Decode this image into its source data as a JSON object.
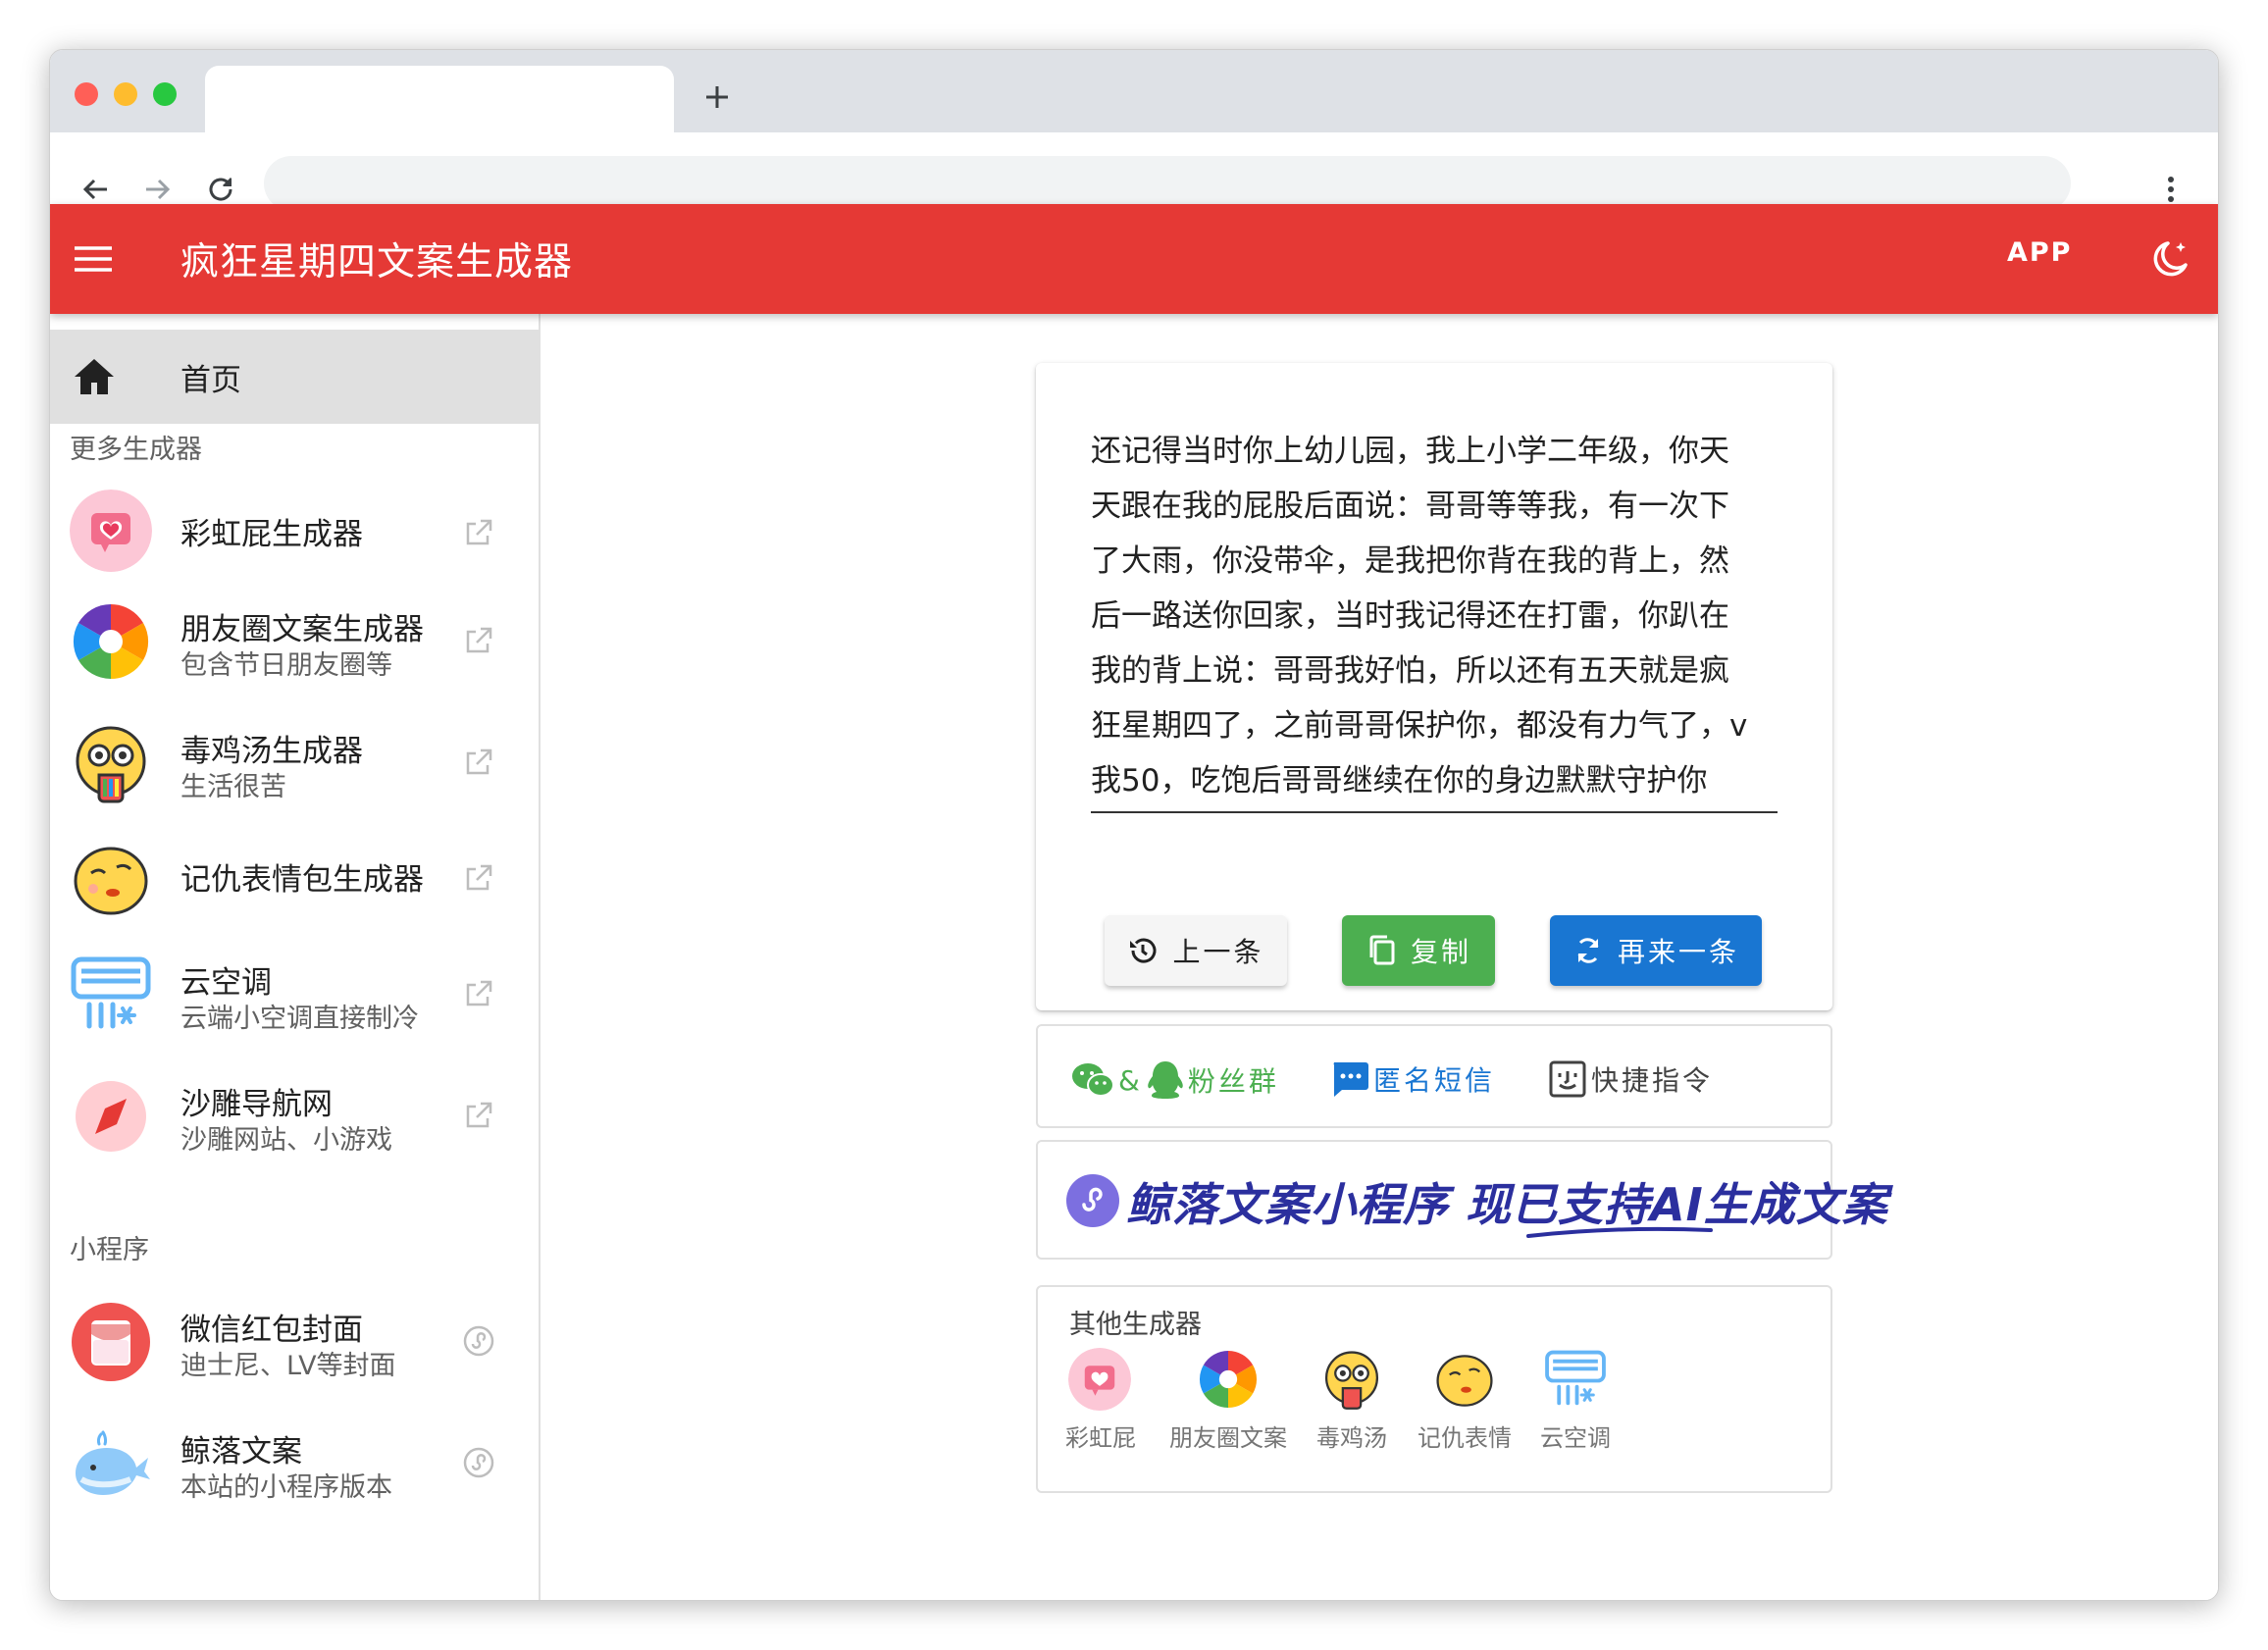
{
  "appbar": {
    "title": "疯狂星期四文案生成器",
    "app_button": "APP"
  },
  "sidebar": {
    "home_label": "首页",
    "section_more": "更多生成器",
    "section_mini": "小程序",
    "items": [
      {
        "title": "彩虹屁生成器",
        "subtitle": ""
      },
      {
        "title": "朋友圈文案生成器",
        "subtitle": "包含节日朋友圈等"
      },
      {
        "title": "毒鸡汤生成器",
        "subtitle": "生活很苦"
      },
      {
        "title": "记仇表情包生成器",
        "subtitle": ""
      },
      {
        "title": "云空调",
        "subtitle": "云端小空调直接制冷"
      },
      {
        "title": "沙雕导航网",
        "subtitle": "沙雕网站、小游戏"
      }
    ],
    "mini_items": [
      {
        "title": "微信红包封面",
        "subtitle": "迪士尼、LV等封面"
      },
      {
        "title": "鲸落文案",
        "subtitle": "本站的小程序版本"
      }
    ]
  },
  "copy": {
    "lines": [
      "还记得当时你上幼儿园，我上小学二年级，你天",
      "天跟在我的屁股后面说：哥哥等等我，有一次下",
      "了大雨，你没带伞，是我把你背在我的背上，然",
      "后一路送你回家，当时我记得还在打雷，你趴在",
      "我的背上说：哥哥我好怕，所以还有五天就是疯",
      "狂星期四了，之前哥哥保护你，都没有力气了，v",
      "我50，吃饱后哥哥继续在你的身边默默守护你"
    ],
    "buttons": {
      "prev": "上一条",
      "copy": "复制",
      "next": "再来一条"
    }
  },
  "links": {
    "fans": "粉丝群",
    "fans_amp": "&",
    "sms": "匿名短信",
    "shortcut": "快捷指令"
  },
  "banner": {
    "text": "鲸落文案小程序 现已支持AI生成文案"
  },
  "others": {
    "title": "其他生成器",
    "items": [
      "彩虹屁",
      "朋友圈文案",
      "毒鸡汤",
      "记仇表情",
      "云空调"
    ]
  },
  "colors": {
    "appbar": "#e53935",
    "copy_btn": "#4caf50",
    "next_btn": "#1976d2",
    "wechat": "#4caf50",
    "link_blue": "#1976d2"
  }
}
